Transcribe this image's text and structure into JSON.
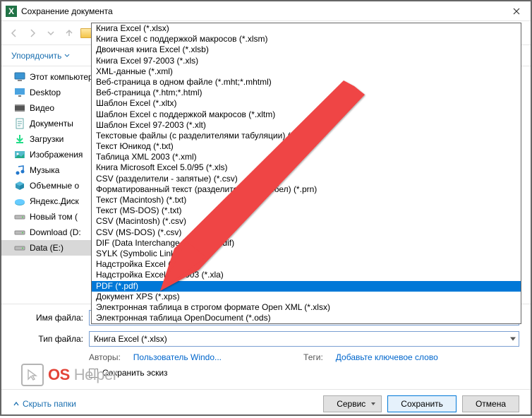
{
  "window": {
    "title": "Сохранение документа"
  },
  "toolbar": {
    "organize": "Упорядочить"
  },
  "sidebar": {
    "items": [
      {
        "label": "Этот компьютер",
        "icon": "monitor"
      },
      {
        "label": "Desktop",
        "icon": "desktop"
      },
      {
        "label": "Видео",
        "icon": "video"
      },
      {
        "label": "Документы",
        "icon": "docs"
      },
      {
        "label": "Загрузки",
        "icon": "download"
      },
      {
        "label": "Изображения",
        "icon": "images"
      },
      {
        "label": "Музыка",
        "icon": "music"
      },
      {
        "label": "Объемные о",
        "icon": "cube"
      },
      {
        "label": "Яндекс.Диск",
        "icon": "yadisk"
      },
      {
        "label": "Новый том (",
        "icon": "drive"
      },
      {
        "label": "Download (D:",
        "icon": "drive"
      },
      {
        "label": "Data (E:)",
        "icon": "drive",
        "selected": true
      }
    ]
  },
  "form": {
    "filename_label": "Имя файла:",
    "filetype_label": "Тип файла:",
    "filetype_value": "Книга Excel (*.xlsx)",
    "authors_label": "Авторы:",
    "authors_value": "Пользователь Windo...",
    "tags_label": "Теги:",
    "tags_value": "Добавьте ключевое слово",
    "save_thumb": "Сохранить эскиз"
  },
  "footer": {
    "hide": "Скрыть папки",
    "service": "Сервис",
    "save": "Сохранить",
    "cancel": "Отмена"
  },
  "filetypes": [
    "Книга Excel (*.xlsx)",
    "Книга Excel с поддержкой макросов (*.xlsm)",
    "Двоичная книга Excel (*.xlsb)",
    "Книга Excel 97-2003 (*.xls)",
    "XML-данные (*.xml)",
    "Веб-страница в одном файле (*.mht;*.mhtml)",
    "Веб-страница (*.htm;*.html)",
    "Шаблон Excel (*.xltx)",
    "Шаблон Excel с поддержкой макросов (*.xltm)",
    "Шаблон Excel 97-2003 (*.xlt)",
    "Текстовые файлы (с разделителями табуляции) (*.txt)",
    "Текст Юникод (*.txt)",
    "Таблица XML 2003 (*.xml)",
    "Книга Microsoft Excel 5.0/95 (*.xls)",
    "CSV (разделители - запятые) (*.csv)",
    "Форматированный текст (разделитель — пробел) (*.prn)",
    "Текст (Macintosh) (*.txt)",
    "Текст (MS-DOS) (*.txt)",
    "CSV (Macintosh) (*.csv)",
    "CSV (MS-DOS) (*.csv)",
    "DIF (Data Interchange Format) (*.dif)",
    "SYLK (Symbolic Link) (*.slk)",
    "Надстройка Excel (*.xlam)",
    "Надстройка Excel 97-2003 (*.xla)",
    "PDF (*.pdf)",
    "Документ XPS (*.xps)",
    "Электронная таблица в строгом формате Open XML (*.xlsx)",
    "Электронная таблица OpenDocument (*.ods)"
  ],
  "filetype_selected_index": 24,
  "watermark": {
    "a": "OS",
    "b": "Helper"
  }
}
